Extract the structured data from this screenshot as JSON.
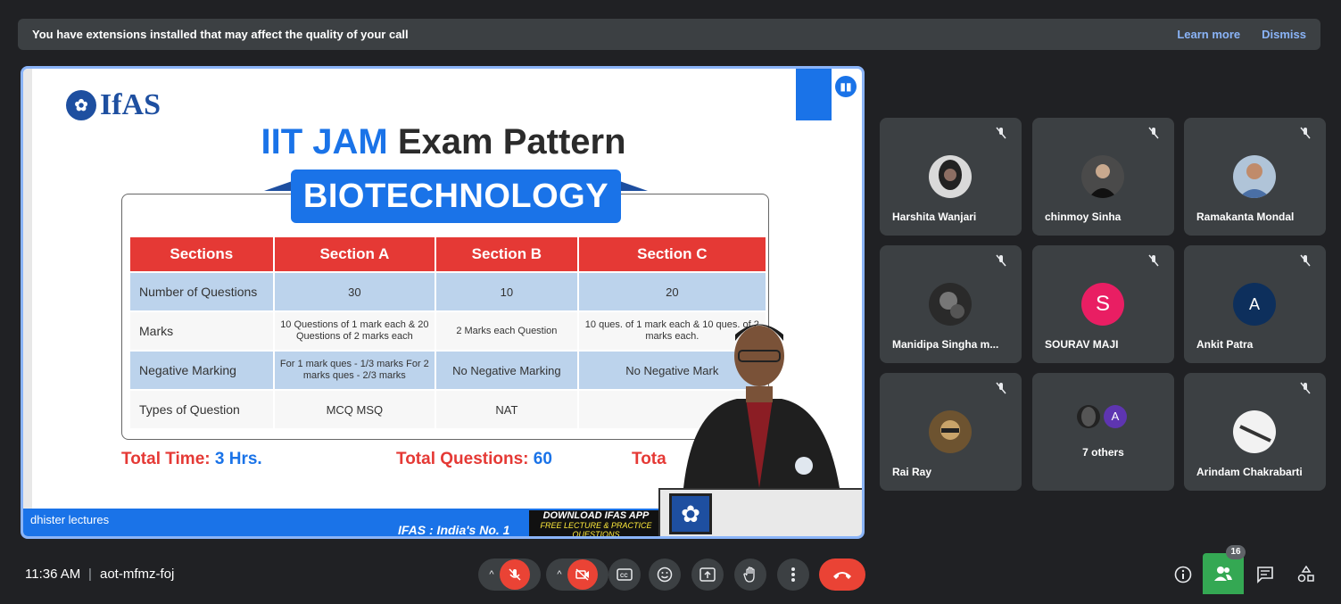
{
  "banner": {
    "text": "You have extensions installed that may affect the quality of your call",
    "learn_more": "Learn more",
    "dismiss": "Dismiss"
  },
  "presentation": {
    "presenter_label": "dhister lectures",
    "slide": {
      "logo_text": "IfAS",
      "title_highlight": "IIT JAM",
      "title_rest": "Exam Pattern",
      "subject": "BIOTECHNOLOGY",
      "table": {
        "headers": [
          "Sections",
          "Section A",
          "Section B",
          "Section C"
        ],
        "rows": [
          [
            "Number of Questions",
            "30",
            "10",
            "20"
          ],
          [
            "Marks",
            "10 Questions of 1 mark each & 20 Questions of 2 marks each",
            "2 Marks each Question",
            "10 ques. of 1 mark each & 10 ques. of 2 marks each."
          ],
          [
            "Negative Marking",
            "For 1 mark ques - 1/3 marks For 2 marks ques - 2/3 marks",
            "No Negative Marking",
            "No Negative Mark"
          ],
          [
            "Types of Question",
            "MCQ MSQ",
            "NAT",
            ""
          ]
        ]
      },
      "total_time_label": "Total Time:",
      "total_time_value": "3 Hrs.",
      "total_questions_label": "Total Questions:",
      "total_questions_value": "60",
      "total_partial": "Tota",
      "footer_ifas": "IFAS : India's No. 1",
      "download_line1": "DOWNLOAD IFAS APP",
      "download_line2": "FREE LECTURE & PRACTICE QUESTIONS"
    }
  },
  "participants": [
    {
      "name": "Harshita Wanjari",
      "muted": true
    },
    {
      "name": "chinmoy Sinha",
      "muted": true
    },
    {
      "name": "Ramakanta Mondal",
      "muted": true
    },
    {
      "name": "Manidipa Singha m...",
      "muted": true
    },
    {
      "name": "SOURAV MAJI",
      "muted": true,
      "initial": "S",
      "color": "#e91e63"
    },
    {
      "name": "Ankit Patra",
      "muted": true,
      "initial": "A",
      "color": "#1565c0"
    },
    {
      "name": "Rai Ray",
      "muted": true
    },
    {
      "name": "7 others",
      "initial": "A",
      "color": "#5e35b1"
    },
    {
      "name": "Arindam Chakrabarti",
      "muted": true
    }
  ],
  "bottom": {
    "time": "11:36 AM",
    "separator": "|",
    "meeting_code": "aot-mfmz-foj",
    "people_count": "16"
  },
  "colors": {
    "background": "#202124",
    "tile": "#3c4043",
    "accent_blue": "#8ab4f8",
    "danger_red": "#ea4335",
    "active_green": "#34a853"
  }
}
